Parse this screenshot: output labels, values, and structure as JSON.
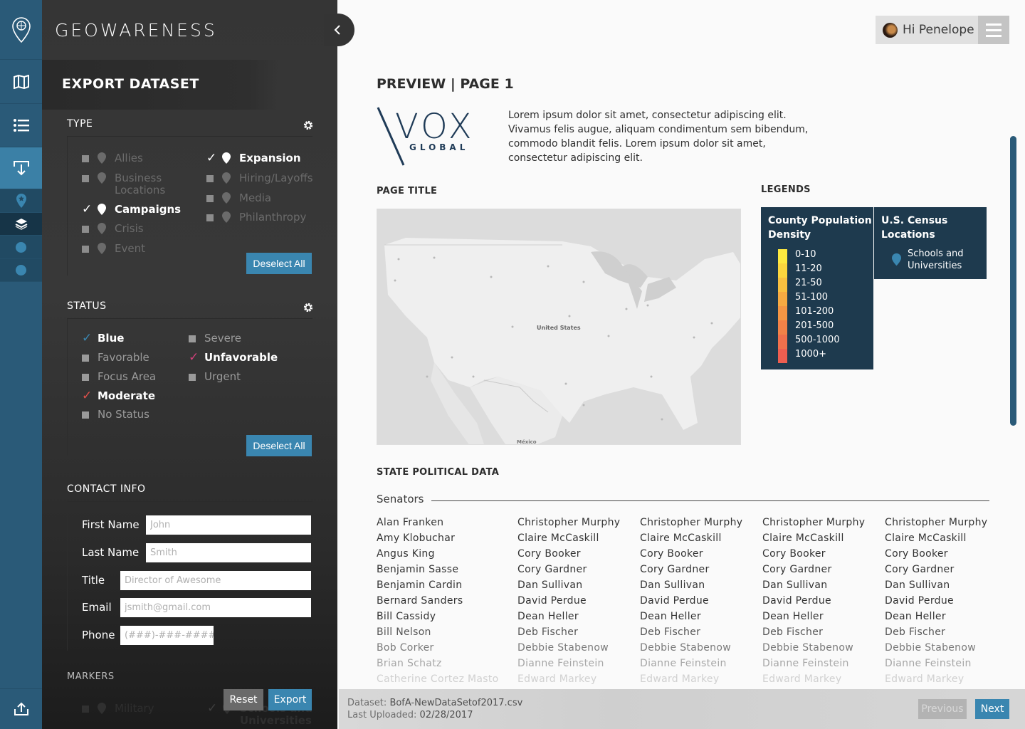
{
  "app": {
    "brand": "GEOWARENESS"
  },
  "rail": {
    "items": [
      "logo-pin",
      "map",
      "list",
      "export",
      "star-pin",
      "layers",
      "dot",
      "dot"
    ],
    "bottom": "upload"
  },
  "panel": {
    "title": "EXPORT DATASET",
    "type": {
      "title": "TYPE",
      "left": [
        {
          "label": "Allies",
          "checked": false
        },
        {
          "label": "Business Locations",
          "checked": false
        },
        {
          "label": "Campaigns",
          "checked": true
        },
        {
          "label": "Crisis",
          "checked": false
        },
        {
          "label": "Event",
          "checked": false
        }
      ],
      "right": [
        {
          "label": "Expansion",
          "checked": true
        },
        {
          "label": "Hiring/Layoffs",
          "checked": false
        },
        {
          "label": "Media",
          "checked": false
        },
        {
          "label": "Philanthropy",
          "checked": false
        }
      ],
      "deselect": "Deselect All"
    },
    "status": {
      "title": "STATUS",
      "left": [
        {
          "label": "Blue",
          "checked": true,
          "color": "#3a86b0"
        },
        {
          "label": "Favorable",
          "checked": false
        },
        {
          "label": "Focus Area",
          "checked": false
        },
        {
          "label": "Moderate",
          "checked": true,
          "color": "#e0504a"
        },
        {
          "label": "No Status",
          "checked": false
        }
      ],
      "right": [
        {
          "label": "Severe",
          "checked": false
        },
        {
          "label": "Unfavorable",
          "checked": true,
          "color": "#d0407a"
        },
        {
          "label": "Urgent",
          "checked": false
        }
      ],
      "deselect": "Deselect All"
    },
    "contact": {
      "title": "CONTACT INFO",
      "first_name": {
        "label": "First Name",
        "placeholder": "John"
      },
      "last_name": {
        "label": "Last Name",
        "placeholder": "Smith"
      },
      "title_field": {
        "label": "Title",
        "placeholder": "Director of Awesome"
      },
      "email": {
        "label": "Email",
        "placeholder": "jsmith@gmail.com"
      },
      "phone": {
        "label": "Phone",
        "placeholder": "(###)-###-####"
      }
    },
    "markers": {
      "title": "MARKERS",
      "items": [
        {
          "label": "Military",
          "checked": false
        },
        {
          "label": "Schools and Universities",
          "checked": true
        }
      ]
    },
    "reset": "Reset",
    "export": "Export"
  },
  "header": {
    "greeting": "Hi Penelope"
  },
  "preview": {
    "title": "PREVIEW | PAGE 1",
    "logo": {
      "main": "VOX",
      "sub": "GLOBAL"
    },
    "lorem": "Lorem ipsum dolor sit amet, consectetur adipiscing elit. Vivamus felis augue, aliquam condimentum sem bibendum, commodo blandit felis. Lorem ipsum dolor sit amet, consectetur adipiscing elit.",
    "page_title_label": "PAGE TITLE",
    "map_label": "United States",
    "map_bottom_label": "México",
    "legends_label": "LEGENDS",
    "legend_density": {
      "title": "County Population Density",
      "ranges": [
        "0-10",
        "11-20",
        "21-50",
        "51-100",
        "101-200",
        "201-500",
        "500-1000",
        "1000+"
      ],
      "colors": [
        "#fde940",
        "#fbd63e",
        "#f8c040",
        "#f6aa42",
        "#f49644",
        "#f28248",
        "#f0704c",
        "#ee5e50"
      ]
    },
    "legend_census": {
      "title": "U.S. Census Locations",
      "item": "Schools and Universities",
      "pin_color": "#3a86b0"
    },
    "political_label": "STATE POLITICAL DATA",
    "senators_label": "Senators",
    "senators": [
      [
        "Alan Franken",
        "Amy Klobuchar",
        "Angus King",
        "Benjamin Sasse",
        "Benjamin Cardin",
        "Bernard Sanders",
        "Bill Cassidy",
        "Bill Nelson",
        "Bob Corker",
        "Brian Schatz",
        "Catherine Cortez Masto"
      ],
      [
        "Christopher Murphy",
        "Claire McCaskill",
        "Cory Booker",
        "Cory Gardner",
        "Dan Sullivan",
        "David Perdue",
        "Dean Heller",
        "Deb Fischer",
        "Debbie Stabenow",
        "Dianne Feinstein",
        "Edward Markey"
      ],
      [
        "Christopher Murphy",
        "Claire McCaskill",
        "Cory Booker",
        "Cory Gardner",
        "Dan Sullivan",
        "David Perdue",
        "Dean Heller",
        "Deb Fischer",
        "Debbie Stabenow",
        "Dianne Feinstein",
        "Edward Markey"
      ],
      [
        "Christopher Murphy",
        "Claire McCaskill",
        "Cory Booker",
        "Cory Gardner",
        "Dan Sullivan",
        "David Perdue",
        "Dean Heller",
        "Deb Fischer",
        "Debbie Stabenow",
        "Dianne Feinstein",
        "Edward Markey"
      ],
      [
        "Christopher Murphy",
        "Claire McCaskill",
        "Cory Booker",
        "Cory Gardner",
        "Dan Sullivan",
        "David Perdue",
        "Dean Heller",
        "Deb Fischer",
        "Debbie Stabenow",
        "Dianne Feinstein",
        "Edward Markey"
      ]
    ]
  },
  "footer": {
    "dataset_label": "Dataset:",
    "dataset_value": "BofA-NewDataSetof2017.csv",
    "uploaded_label": "Last Uploaded:",
    "uploaded_value": "02/28/2017",
    "previous": "Previous",
    "next": "Next"
  },
  "colors": {
    "accent": "#3a86b0",
    "rail": "#2a5a78",
    "legend_bg": "#1e3a4e"
  }
}
